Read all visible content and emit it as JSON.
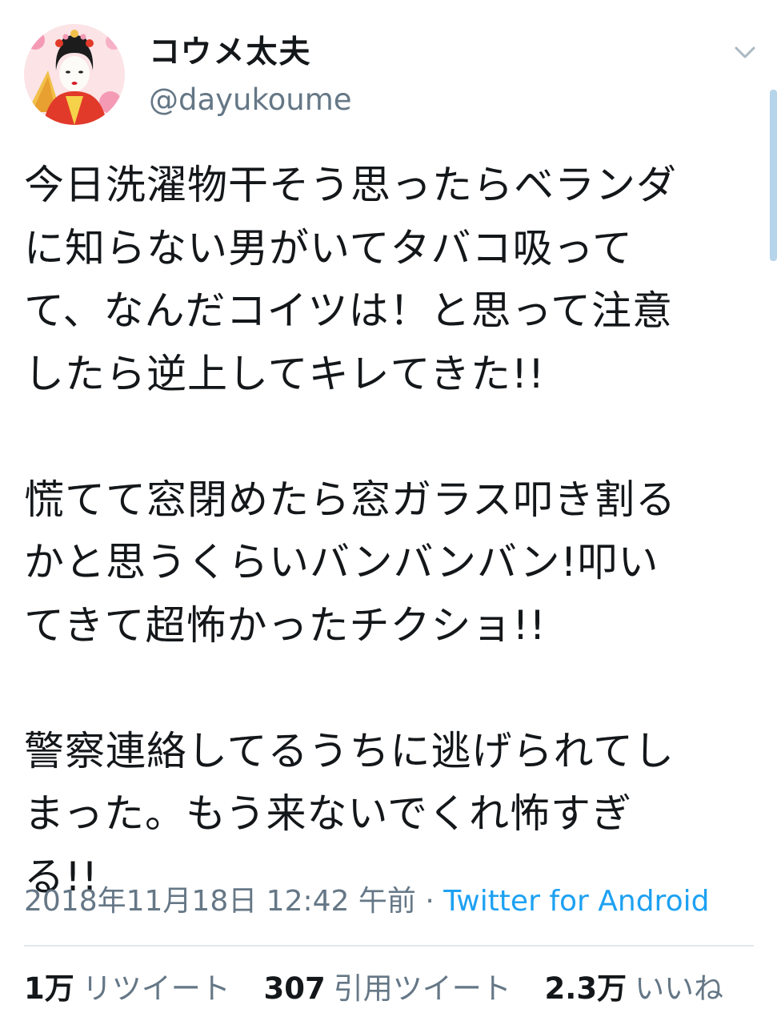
{
  "user": {
    "display_name": "コウメ太夫",
    "handle": "@dayukoume",
    "avatar_icon": "user-avatar-photo"
  },
  "menu_icon": "chevron-down-icon",
  "tweet": {
    "paragraphs": [
      {
        "lines": [
          "今日洗濯物干そう思ったらベランダ",
          "に知らない男がいてタバコ吸って",
          "て、なんだコイツは！と思って注意",
          "したら逆上してキレてきた!!"
        ]
      },
      {
        "lines": [
          "慌てて窓閉めたら窓ガラス叩き割る",
          "かと思うくらいバンバンバン!叩い",
          "てきて超怖かったチクショ!!"
        ]
      },
      {
        "lines": [
          "警察連絡してるうちに逃げられてし",
          "まった。もう来ないでくれ怖すぎ",
          "る!!"
        ]
      }
    ],
    "timestamp": "2018年11月18日 12:42 午前",
    "separator": " · ",
    "source": "Twitter for Android"
  },
  "stats": {
    "retweets_count": "1万",
    "retweets_label": "リツイート",
    "quotes_count": "307",
    "quotes_label": "引用ツイート",
    "likes_count": "2.3万",
    "likes_label": "いいね"
  },
  "colors": {
    "text": "#14171a",
    "secondary": "#657786",
    "link": "#1da1f2",
    "divider": "#e1e8ed"
  }
}
